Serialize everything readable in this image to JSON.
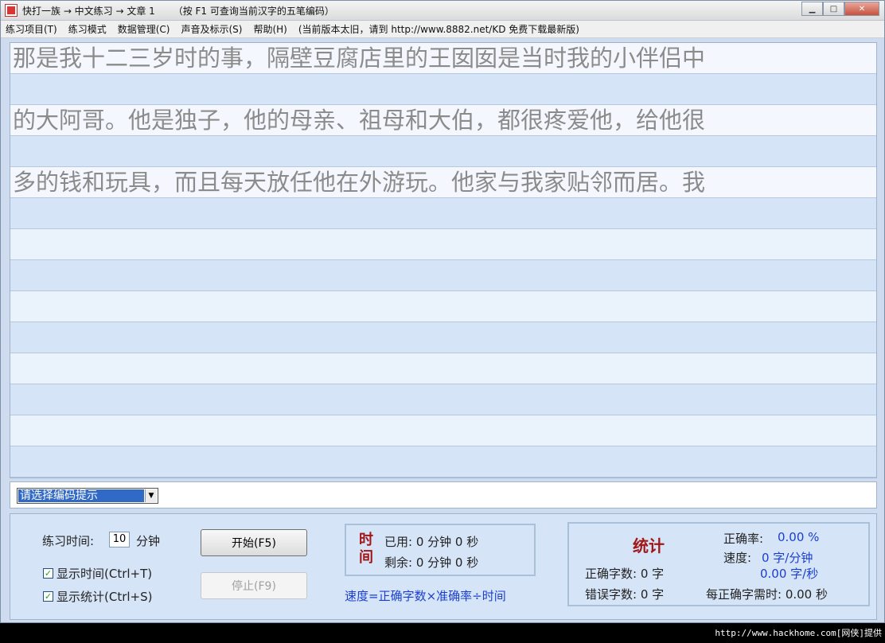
{
  "titlebar": {
    "title": "快打一族 → 中文练习 → 文章 1      （按 F1 可查询当前汉字的五笔编码）",
    "min": "▁",
    "max": "□",
    "close": "✕"
  },
  "menu": {
    "items": [
      "练习项目(T)",
      "练习模式",
      "数据管理(C)",
      "声音及标示(S)",
      "帮助(H)"
    ],
    "note": "(当前版本太旧，请到 http://www.8882.net/KD 免费下载最新版)"
  },
  "practice": {
    "lines": [
      "那是我十二三岁时的事，隔壁豆腐店里的王囡囡是当时我的小伴侣中",
      "的大阿哥。他是独子，他的母亲、祖母和大伯，都很疼爱他，给他很",
      "多的钱和玩具，而且每天放任他在外游玩。他家与我家贴邻而居。我"
    ]
  },
  "hint": {
    "select_value": "请选择编码提示",
    "arrow": "▼"
  },
  "controls": {
    "time_label": "练习时间:",
    "time_value": "10",
    "time_unit": "分钟",
    "show_time": "显示时间(Ctrl+T)",
    "show_stats": "显示统计(Ctrl+S)",
    "check_mark": "✓",
    "start": "开始(F5)",
    "stop": "停止(F9)"
  },
  "timebox": {
    "title": "时间",
    "used": "已用: 0 分钟 0 秒",
    "remaining": "剩余: 0 分钟 0 秒"
  },
  "formula": "速度=正确字数×准确率÷时间",
  "stats": {
    "title": "统计",
    "accuracy_label": "正确率:",
    "accuracy_value": "0.00 %",
    "speed_label": "速度:",
    "speed_value1": "0 字/分钟",
    "speed_value2": "0.00 字/秒",
    "correct_label": "正确字数: 0 字",
    "wrong_label": "错误字数: 0 字",
    "per_char_label": "每正确字需时: 0.00 秒"
  },
  "watermark": "http://www.hackhome.com[网侠]提供"
}
